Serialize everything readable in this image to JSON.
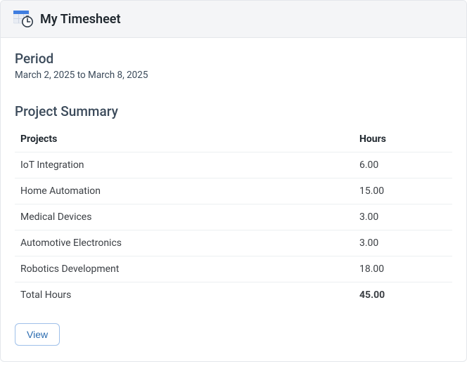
{
  "header": {
    "title": "My Timesheet",
    "icon": "timesheet-clock-icon"
  },
  "period": {
    "label": "Period",
    "range": "March 2, 2025 to March 8, 2025"
  },
  "summary": {
    "title": "Project Summary",
    "columns": {
      "project": "Projects",
      "hours": "Hours"
    },
    "rows": [
      {
        "project": "IoT Integration",
        "hours": "6.00"
      },
      {
        "project": "Home Automation",
        "hours": "15.00"
      },
      {
        "project": "Medical Devices",
        "hours": "3.00"
      },
      {
        "project": "Automotive Electronics",
        "hours": "3.00"
      },
      {
        "project": "Robotics Development",
        "hours": "18.00"
      }
    ],
    "total": {
      "label": "Total Hours",
      "hours": "45.00"
    }
  },
  "actions": {
    "view": "View"
  }
}
